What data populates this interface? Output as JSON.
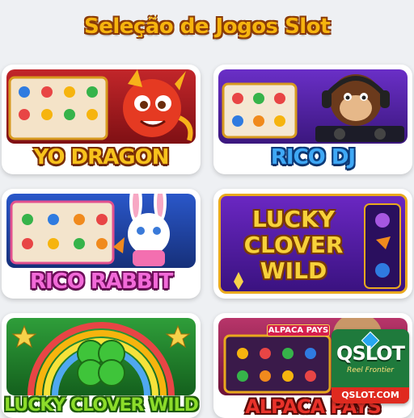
{
  "page": {
    "title": "Seleção de Jogos Slot"
  },
  "games": [
    {
      "id": "yo-dragon",
      "label": "YO DRAGON"
    },
    {
      "id": "rico-dj",
      "label": "RICO DJ"
    },
    {
      "id": "rico-rabbit",
      "label": "RICO RABBIT"
    },
    {
      "id": "lucky-clover-wild-art",
      "art_title": [
        "LUCKY",
        "CLOVER",
        "WILD"
      ]
    },
    {
      "id": "lucky-clover-wild",
      "label": "LUCKY CLOVER WILD"
    },
    {
      "id": "alpaca-pays",
      "label": "ALPACA PAYS",
      "art_banner": "ALPACA PAYS"
    }
  ],
  "badge": {
    "brand": "QSLOT",
    "tagline": "Reel Frontier",
    "url": "QSLOT.COM"
  },
  "colors": {
    "title": "#f6b40e",
    "gold_label": "#f7c21c",
    "blue_label": "#3fa8f5",
    "pink_label": "#f26ad8",
    "green_label": "#8cdc2a",
    "red_label": "#e8322a"
  }
}
